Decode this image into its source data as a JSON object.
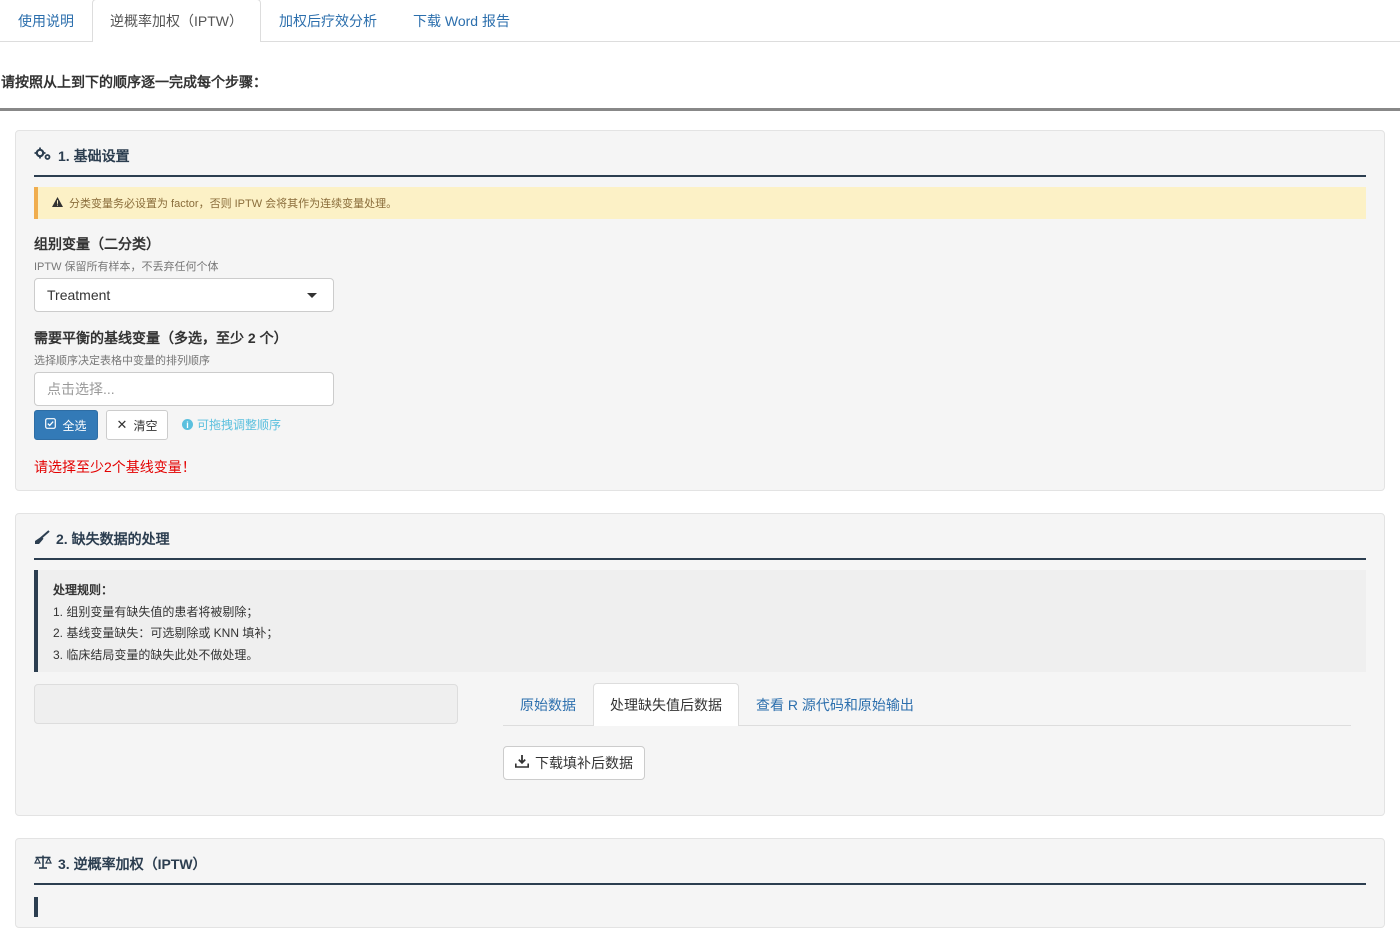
{
  "top_tabs": [
    "使用说明",
    "逆概率加权（IPTW）",
    "加权后疗效分析",
    "下载 Word 报告"
  ],
  "active_top_tab": 1,
  "intro": "请按照从上到下的顺序逐一完成每个步骤：",
  "section1": {
    "title": "1. 基础设置",
    "icon": "gears-icon",
    "warning": "分类变量务必设置为 factor，否则 IPTW 会将其作为连续变量处理。",
    "group_label": "组别变量（二分类）",
    "group_help": "IPTW 保留所有样本，不丢弃任何个体",
    "group_value": "Treatment",
    "covar_label": "需要平衡的基线变量（多选，至少 2 个）",
    "covar_help": "选择顺序决定表格中变量的排列顺序",
    "covar_placeholder": "点击选择...",
    "select_all": "全选",
    "clear": "清空",
    "drag_hint": "可拖拽调整顺序",
    "error": "请选择至少2个基线变量！"
  },
  "section2": {
    "title": "2. 缺失数据的处理",
    "icon": "broom-icon",
    "rules_title": "处理规则：",
    "rules": [
      "1. 组别变量有缺失值的患者将被剔除；",
      "2. 基线变量缺失：可选剔除或 KNN 填补；",
      "3. 临床结局变量的缺失此处不做处理。"
    ],
    "tabs": [
      "原始数据",
      "处理缺失值后数据",
      "查看 R 源代码和原始输出"
    ],
    "active_tab": 1,
    "download": "下载填补后数据"
  },
  "section3": {
    "title": "3. 逆概率加权（IPTW）",
    "icon": "balance-scale-icon"
  },
  "colors": {
    "link": "#2c6fad",
    "primary": "#337ab7",
    "warning_bg": "#fcf1c6",
    "error": "#e30000",
    "heading": "#2c3e50"
  }
}
